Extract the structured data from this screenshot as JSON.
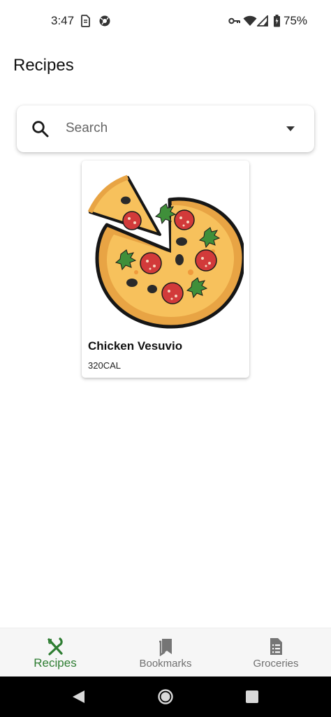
{
  "status_bar": {
    "time": "3:47",
    "battery_percent": "75%",
    "icons": [
      "sim-icon",
      "settings-icon",
      "vpn-key-icon",
      "wifi-icon",
      "signal-icon",
      "battery-icon"
    ]
  },
  "header": {
    "title": "Recipes"
  },
  "search": {
    "placeholder": "Search",
    "value": ""
  },
  "recipes": [
    {
      "name": "Chicken Vesuvio",
      "calories": "320CAL",
      "image": "pizza-image"
    }
  ],
  "bottom_nav": {
    "items": [
      {
        "label": "Recipes",
        "icon": "fork-knife-icon",
        "active": true
      },
      {
        "label": "Bookmarks",
        "icon": "bookmarks-icon",
        "active": false
      },
      {
        "label": "Groceries",
        "icon": "grocery-list-icon",
        "active": false
      }
    ],
    "active_color": "#2e7d32",
    "inactive_color": "#707070"
  },
  "system_nav": {
    "buttons": [
      "back-button",
      "home-button",
      "recents-button"
    ]
  }
}
